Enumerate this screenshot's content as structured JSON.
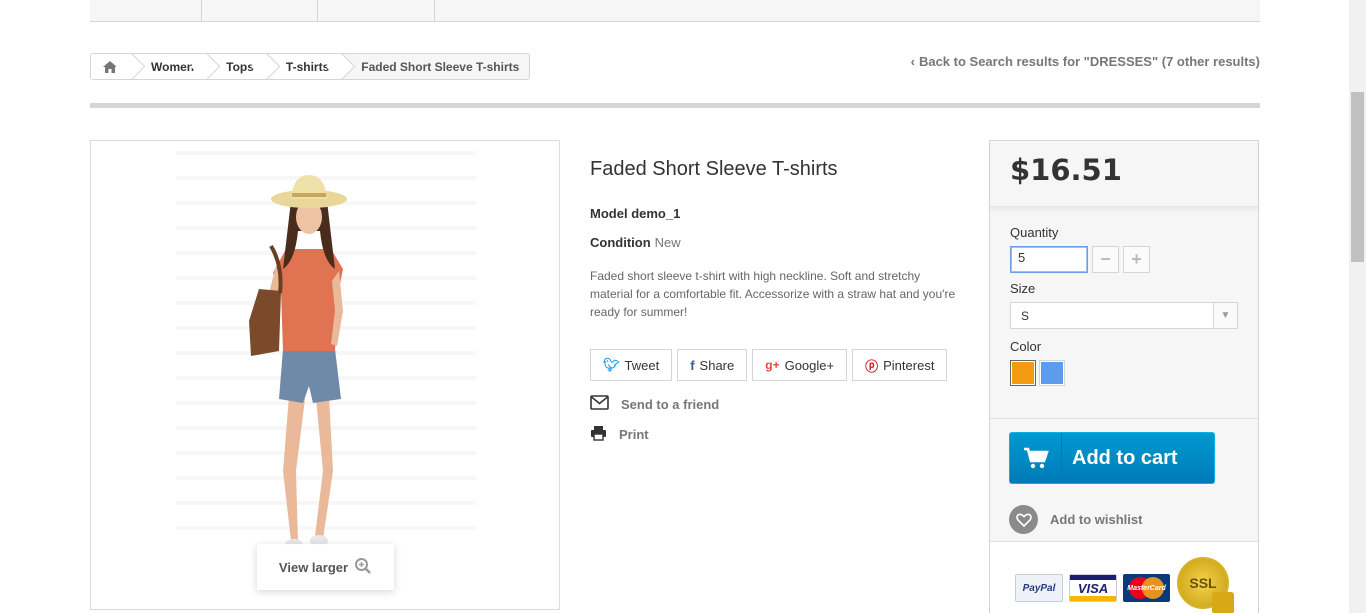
{
  "breadcrumb": {
    "home_icon": "home-icon",
    "items": [
      "Women",
      "Tops",
      "T-shirts"
    ],
    "current": "Faded Short Sleeve T-shirts"
  },
  "back_link": "Back to Search results for \"DRESSES\" (7 other results)",
  "image": {
    "view_larger": "View larger"
  },
  "product": {
    "title": "Faded Short Sleeve T-shirts",
    "model_label": "Model",
    "model_value": "demo_1",
    "condition_label": "Condition",
    "condition_value": "New",
    "description": "Faded short sleeve t-shirt with high neckline. Soft and stretchy material for a comfortable fit. Accessorize with a straw hat and you're ready for summer!"
  },
  "social": {
    "tweet": "Tweet",
    "share": "Share",
    "google": "Google+",
    "pinterest": "Pinterest"
  },
  "links": {
    "send_friend": "Send to a friend",
    "print": "Print"
  },
  "buy": {
    "price": "$16.51",
    "quantity_label": "Quantity",
    "quantity_value": "5",
    "size_label": "Size",
    "size_value": "S",
    "color_label": "Color",
    "colors": [
      "#f39c11",
      "#5d9cec"
    ],
    "add_to_cart": "Add to cart",
    "add_to_wishlist": "Add to wishlist"
  },
  "payments": {
    "paypal": "PayPal",
    "visa": "VISA",
    "mastercard": "MasterCard",
    "ssl": "SSL"
  }
}
